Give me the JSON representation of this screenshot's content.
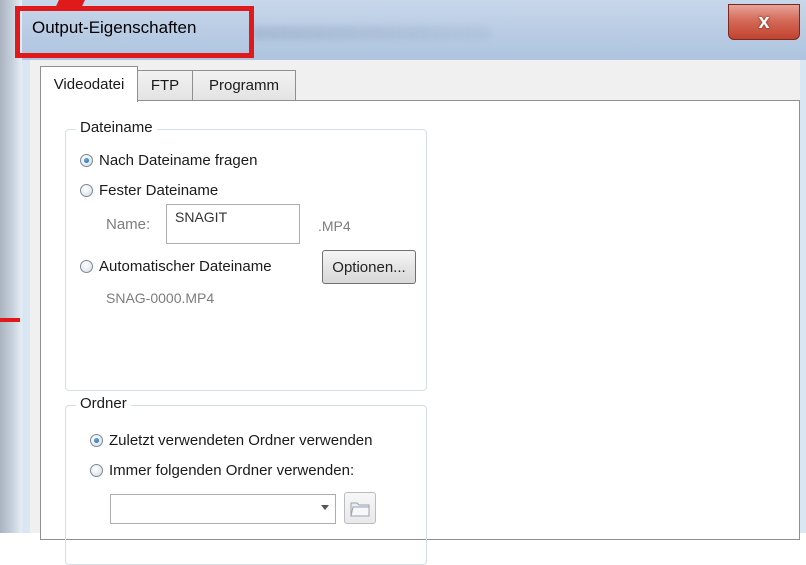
{
  "window": {
    "title": "Output-Eigenschaften",
    "close_symbol": "x",
    "accent_color": "#e01a1a"
  },
  "tabs": [
    {
      "label": "Videodatei",
      "active": true
    },
    {
      "label": "FTP",
      "active": false
    },
    {
      "label": "Programm",
      "active": false
    }
  ],
  "dateiname": {
    "legend": "Dateiname",
    "option_ask": {
      "label": "Nach Dateiname fragen",
      "checked": true
    },
    "option_fixed": {
      "label": "Fester Dateiname",
      "checked": false
    },
    "name_label": "Name:",
    "name_value": "SNAGIT",
    "extension": ".MP4",
    "option_auto": {
      "label": "Automatischer Dateiname",
      "checked": false
    },
    "options_button": "Optionen...",
    "auto_preview": "SNAG-0000.MP4"
  },
  "ordner": {
    "legend": "Ordner",
    "option_last": {
      "label": "Zuletzt verwendeten Ordner verwenden",
      "checked": true
    },
    "option_always": {
      "label": "Immer folgenden Ordner verwenden:",
      "checked": false
    },
    "folder_value": ""
  },
  "icons": {
    "close": "close-icon",
    "combo_arrow": "chevron-down-icon",
    "browse": "folder-icon"
  }
}
